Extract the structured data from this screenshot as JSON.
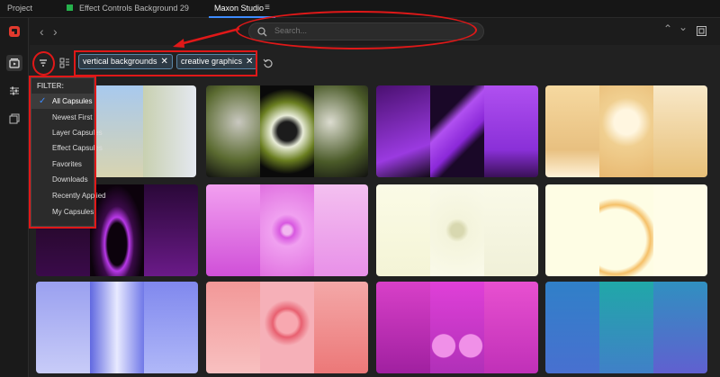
{
  "tabs": {
    "project": "Project",
    "effect_controls": "Effect Controls Background 29",
    "maxon": "Maxon Studio",
    "menu": "≡"
  },
  "search": {
    "placeholder": "Search..."
  },
  "chips": [
    {
      "label": "vertical backgrounds",
      "close": "✕"
    },
    {
      "label": "creative graphics",
      "close": "✕"
    }
  ],
  "filter_menu": {
    "title": "FILTER:",
    "items": [
      "All Capsules",
      "Newest First",
      "Layer Capsules",
      "Effect Capsules",
      "Favorites",
      "Downloads",
      "Recently Applied",
      "My Capsules"
    ],
    "selected": "All Capsules",
    "check": "✓"
  },
  "colors": {
    "accent": "#3d8bfd",
    "annotation_red": "#e01818",
    "chip_border": "#5a86a8"
  },
  "icons": [
    "back-arrow-icon",
    "forward-arrow-icon",
    "search-icon",
    "filter-icon",
    "layout-icon",
    "reset-icon",
    "chevron-up-icon",
    "chevron-down-icon",
    "expand-icon",
    "maxon-logo-icon",
    "capsules-icon",
    "sliders-icon",
    "library-icon"
  ]
}
